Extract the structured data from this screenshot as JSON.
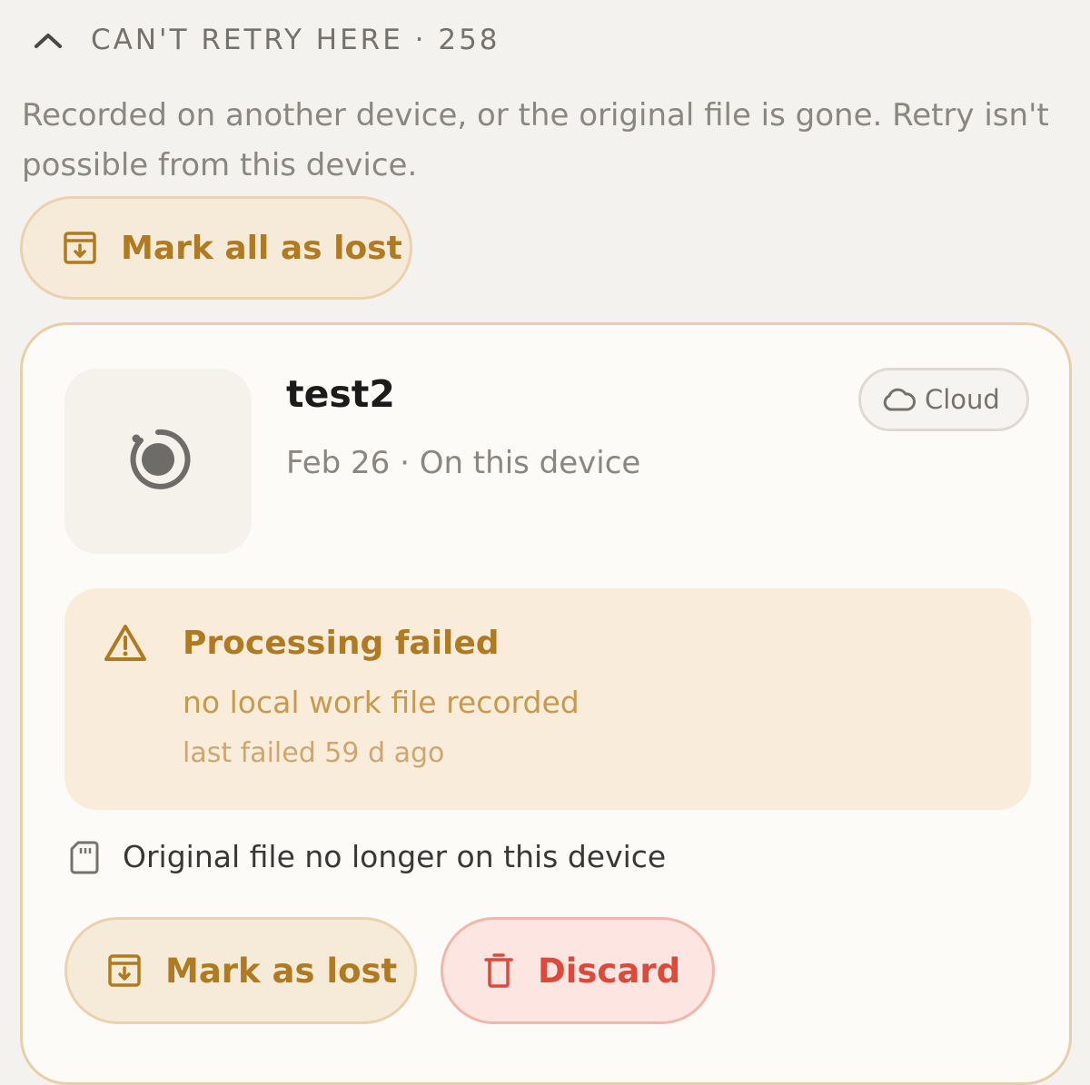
{
  "section": {
    "chevron_icon": "chevron-up-icon",
    "title": "CAN'T RETRY HERE · 258",
    "description": "Recorded on another device, or the original file is gone. Retry isn't possible from this device.",
    "mark_all_label": "Mark all as lost"
  },
  "recording": {
    "title": "test2",
    "meta": "Feb 26 · On this device",
    "status_icon": "recording-icon",
    "cloud_label": "Cloud",
    "failure": {
      "title": "Processing failed",
      "reason": "no local work file recorded",
      "last_failed": "last failed 59 d ago"
    },
    "file_note": "Original file no longer on this device",
    "actions": {
      "mark_lost_label": "Mark as lost",
      "discard_label": "Discard"
    }
  },
  "colors": {
    "accent_amber": "#b07a20",
    "danger": "#dd4a3a",
    "background": "#f4f2ee"
  }
}
